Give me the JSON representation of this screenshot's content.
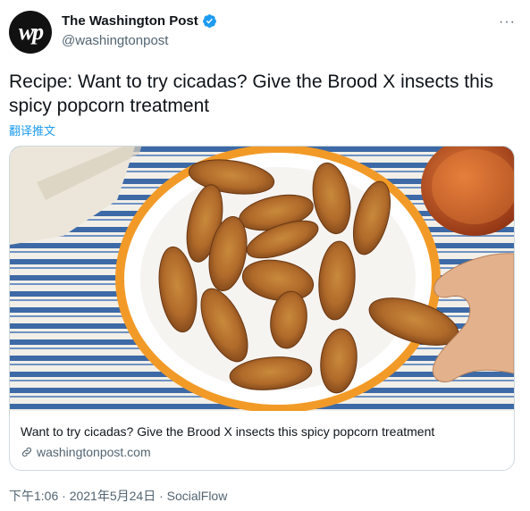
{
  "account": {
    "avatar_text": "wp",
    "display_name": "The Washington Post",
    "handle": "@washingtonpost",
    "verified_color": "#1d9bf0"
  },
  "menu": {
    "more_label": "···"
  },
  "tweet": {
    "text": "Recipe: Want to try cicadas? Give the Brood X insects this spicy popcorn treatment",
    "translate_label": "翻译推文"
  },
  "card": {
    "caption": "Want to try cicadas? Give the Brood X insects this spicy popcorn treatment",
    "domain": "washingtonpost.com"
  },
  "meta": {
    "time_date": "下午1:06 · 2021年5月24日 · ",
    "source": "SocialFlow"
  }
}
